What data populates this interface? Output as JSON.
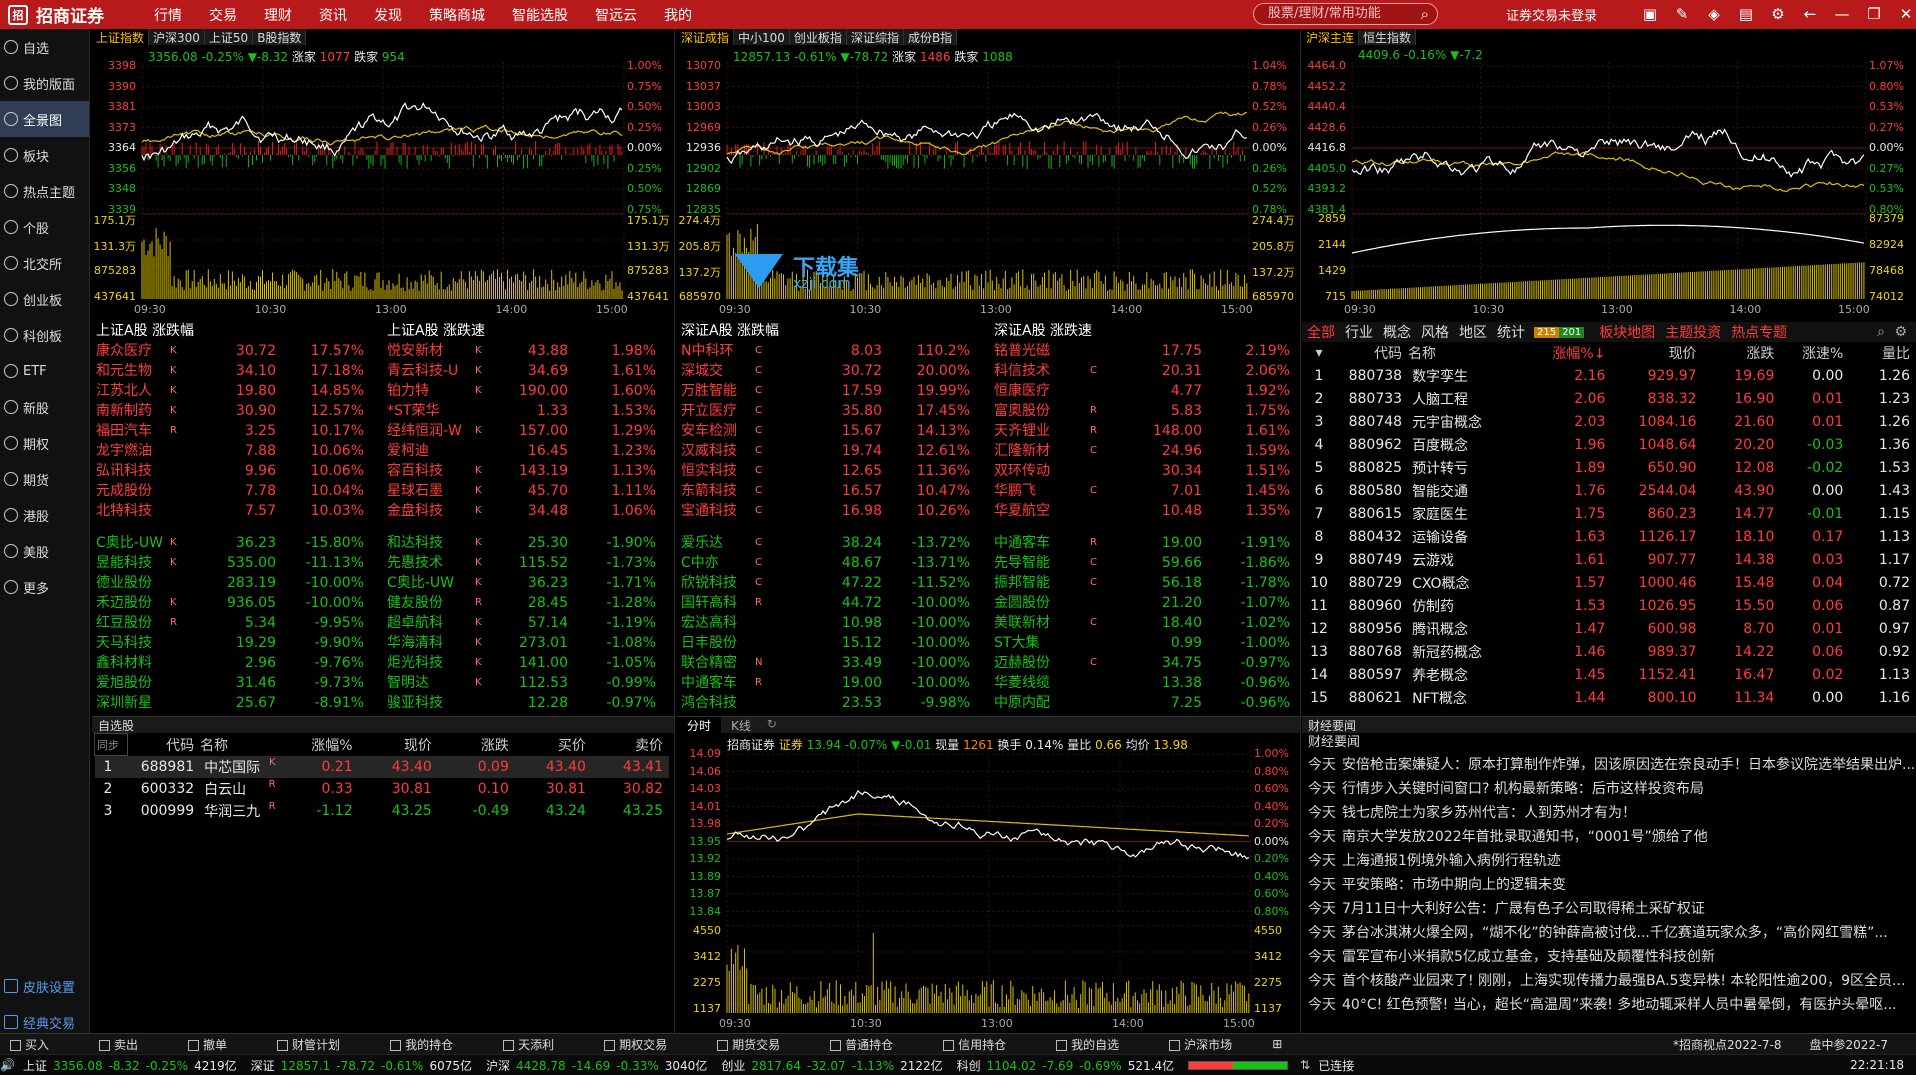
{
  "app": {
    "logo": "招商证券",
    "menu": [
      "行情",
      "交易",
      "理财",
      "资讯",
      "发现",
      "策略商城",
      "智能选股",
      "智远云",
      "我的"
    ],
    "search_placeholder": "股票/理财/常用功能",
    "login": "证券交易未登录"
  },
  "sidebar": [
    {
      "label": "自选",
      "icon": "star-icon"
    },
    {
      "label": "我的版面",
      "icon": "layout-icon"
    },
    {
      "label": "全景图",
      "icon": "panorama-icon",
      "active": true
    },
    {
      "label": "板块",
      "icon": "sector-icon"
    },
    {
      "label": "热点主题",
      "icon": "fire-icon"
    },
    {
      "label": "个股",
      "icon": "stock-icon"
    },
    {
      "label": "北交所",
      "icon": "bse-icon"
    },
    {
      "label": "创业板",
      "icon": "gem-icon"
    },
    {
      "label": "科创板",
      "icon": "star-market-icon"
    },
    {
      "label": "ETF",
      "icon": "etf-icon"
    },
    {
      "label": "新股",
      "icon": "ipo-icon"
    },
    {
      "label": "期权",
      "icon": "option-icon"
    },
    {
      "label": "期货",
      "icon": "futures-icon"
    },
    {
      "label": "港股",
      "icon": "hk-icon"
    },
    {
      "label": "美股",
      "icon": "us-icon"
    },
    {
      "label": "更多",
      "icon": "more-icon"
    }
  ],
  "sidebar_bottom": [
    "皮肤设置",
    "经典交易"
  ],
  "charts": [
    {
      "tabs": [
        "上证指数",
        "沪深300",
        "上证50",
        "B股指数"
      ],
      "quote": {
        "price": "3356.08",
        "pct": "-0.25%",
        "chg": "▼-8.32",
        "up_label": "涨家",
        "up": "1077",
        "down_label": "跌家",
        "down": "954"
      },
      "y_left": [
        "3398",
        "3390",
        "3381",
        "3373",
        "3364",
        "3356",
        "3348",
        "3339"
      ],
      "y_right": [
        "1.00%",
        "0.75%",
        "0.50%",
        "0.25%",
        "0.00%",
        "0.25%",
        "0.50%",
        "0.75%"
      ],
      "vol_left": [
        "175.1万",
        "131.3万",
        "875283",
        "437641"
      ],
      "vol_right": [
        "175.1万",
        "131.3万",
        "875283",
        "437641"
      ],
      "x": [
        "09:30",
        "10:30",
        "13:00",
        "14:00",
        "15:00"
      ]
    },
    {
      "tabs": [
        "深证成指",
        "中小100",
        "创业板指",
        "深证综指",
        "成份B指"
      ],
      "quote": {
        "price": "12857.13",
        "pct": "-0.61%",
        "chg": "▼-78.72",
        "up_label": "涨家",
        "up": "1486",
        "down_label": "跌家",
        "down": "1088"
      },
      "y_left": [
        "13070",
        "13037",
        "13003",
        "12969",
        "12936",
        "12902",
        "12869",
        "12835"
      ],
      "y_right": [
        "1.04%",
        "0.78%",
        "0.52%",
        "0.26%",
        "0.00%",
        "0.26%",
        "0.52%",
        "0.78%"
      ],
      "vol_left": [
        "274.4万",
        "205.8万",
        "137.2万",
        "685970"
      ],
      "vol_right": [
        "274.4万",
        "205.8万",
        "137.2万",
        "685970"
      ],
      "x": [
        "09:30",
        "10:30",
        "13:00",
        "14:00",
        "15:00"
      ]
    },
    {
      "tabs": [
        "沪深主连",
        "恒生指数"
      ],
      "quote": {
        "price": "4409.6",
        "pct": "-0.16%",
        "chg": "▼-7.2"
      },
      "y_left": [
        "4464.0",
        "4452.2",
        "4440.4",
        "4428.6",
        "4416.8",
        "4405.0",
        "4393.2",
        "4381.4"
      ],
      "y_right": [
        "1.07%",
        "0.80%",
        "0.53%",
        "0.27%",
        "0.00%",
        "0.27%",
        "0.53%",
        "0.80%"
      ],
      "vol_left": [
        "2859",
        "2144",
        "1429",
        "715"
      ],
      "vol_right": [
        "87379",
        "82924",
        "78468",
        "74012"
      ],
      "x": [
        "09:30",
        "10:30",
        "13:00",
        "14:00",
        "15:00"
      ]
    }
  ],
  "watermark": {
    "text": "下载集",
    "sub": "xzji.com"
  },
  "rankings": [
    {
      "title": "上证A股 涨跌幅",
      "up": [
        [
          "康众医疗",
          "K",
          "30.72",
          "17.57%"
        ],
        [
          "和元生物",
          "K",
          "34.10",
          "17.18%"
        ],
        [
          "江苏北人",
          "K",
          "19.80",
          "14.85%"
        ],
        [
          "南新制药",
          "K",
          "30.90",
          "12.57%"
        ],
        [
          "福田汽车",
          "R",
          "3.25",
          "10.17%"
        ],
        [
          "龙宇燃油",
          "",
          "7.88",
          "10.06%"
        ],
        [
          "弘讯科技",
          "",
          "9.96",
          "10.06%"
        ],
        [
          "元成股份",
          "",
          "7.78",
          "10.04%"
        ],
        [
          "北特科技",
          "",
          "7.57",
          "10.03%"
        ]
      ],
      "down": [
        [
          "C奥比-UW",
          "K",
          "36.23",
          "-15.80%"
        ],
        [
          "昱能科技",
          "K",
          "535.00",
          "-11.13%"
        ],
        [
          "德业股份",
          "",
          "283.19",
          "-10.00%"
        ],
        [
          "禾迈股份",
          "K",
          "936.05",
          "-10.00%"
        ],
        [
          "红豆股份",
          "R",
          "5.34",
          "-9.95%"
        ],
        [
          "天马科技",
          "",
          "19.29",
          "-9.90%"
        ],
        [
          "鑫科材料",
          "",
          "2.96",
          "-9.76%"
        ],
        [
          "爱旭股份",
          "",
          "31.46",
          "-9.73%"
        ],
        [
          "深圳新星",
          "",
          "25.67",
          "-8.91%"
        ]
      ]
    },
    {
      "title": "上证A股 涨跌速",
      "up": [
        [
          "悦安新材",
          "K",
          "43.88",
          "1.98%"
        ],
        [
          "青云科技-U",
          "K",
          "34.69",
          "1.61%"
        ],
        [
          "铂力特",
          "K",
          "190.00",
          "1.60%"
        ],
        [
          "*ST荣华",
          "",
          "1.33",
          "1.53%"
        ],
        [
          "经纬恒润-W",
          "K",
          "157.00",
          "1.29%"
        ],
        [
          "爱柯迪",
          "",
          "16.45",
          "1.23%"
        ],
        [
          "容百科技",
          "K",
          "143.19",
          "1.13%"
        ],
        [
          "星球石墨",
          "K",
          "45.70",
          "1.11%"
        ],
        [
          "金盘科技",
          "K",
          "34.48",
          "1.06%"
        ]
      ],
      "down": [
        [
          "和达科技",
          "K",
          "25.30",
          "-1.90%"
        ],
        [
          "先惠技术",
          "K",
          "115.52",
          "-1.73%"
        ],
        [
          "C奥比-UW",
          "K",
          "36.23",
          "-1.71%"
        ],
        [
          "健友股份",
          "R",
          "28.45",
          "-1.28%"
        ],
        [
          "超卓航科",
          "K",
          "57.14",
          "-1.19%"
        ],
        [
          "华海清科",
          "K",
          "273.01",
          "-1.08%"
        ],
        [
          "炬光科技",
          "K",
          "141.00",
          "-1.05%"
        ],
        [
          "智明达",
          "K",
          "112.53",
          "-0.99%"
        ],
        [
          "骏亚科技",
          "",
          "12.28",
          "-0.97%"
        ]
      ]
    },
    {
      "title": "深证A股 涨跌幅",
      "up": [
        [
          "N中科环",
          "C",
          "8.03",
          "110.2%"
        ],
        [
          "深城交",
          "C",
          "30.72",
          "20.00%"
        ],
        [
          "万胜智能",
          "C",
          "17.59",
          "19.99%"
        ],
        [
          "开立医疗",
          "C",
          "35.80",
          "17.45%"
        ],
        [
          "安车检测",
          "C",
          "15.67",
          "14.13%"
        ],
        [
          "汉威科技",
          "C",
          "19.74",
          "12.61%"
        ],
        [
          "恒实科技",
          "C",
          "12.65",
          "11.36%"
        ],
        [
          "东箭科技",
          "C",
          "16.57",
          "10.47%"
        ],
        [
          "宝通科技",
          "C",
          "16.98",
          "10.26%"
        ]
      ],
      "down": [
        [
          "爱乐达",
          "C",
          "38.24",
          "-13.72%"
        ],
        [
          "C中亦",
          "C",
          "48.67",
          "-13.71%"
        ],
        [
          "欣锐科技",
          "C",
          "47.22",
          "-11.52%"
        ],
        [
          "国轩高科",
          "R",
          "44.72",
          "-10.00%"
        ],
        [
          "宏达高科",
          "",
          "10.98",
          "-10.00%"
        ],
        [
          "日丰股份",
          "",
          "15.12",
          "-10.00%"
        ],
        [
          "联合精密",
          "N",
          "33.49",
          "-10.00%"
        ],
        [
          "中通客车",
          "R",
          "19.00",
          "-10.00%"
        ],
        [
          "鸿合科技",
          "",
          "23.53",
          "-9.98%"
        ]
      ]
    },
    {
      "title": "深证A股 涨跌速",
      "up": [
        [
          "铭普光磁",
          "",
          "17.75",
          "2.19%"
        ],
        [
          "科信技术",
          "C",
          "20.31",
          "2.06%"
        ],
        [
          "恒康医疗",
          "",
          "4.77",
          "1.92%"
        ],
        [
          "富奥股份",
          "R",
          "5.83",
          "1.75%"
        ],
        [
          "天齐锂业",
          "R",
          "148.00",
          "1.61%"
        ],
        [
          "汇隆新材",
          "C",
          "24.96",
          "1.59%"
        ],
        [
          "双环传动",
          "",
          "30.34",
          "1.51%"
        ],
        [
          "华鹏飞",
          "C",
          "7.01",
          "1.45%"
        ],
        [
          "华夏航空",
          "",
          "10.48",
          "1.35%"
        ]
      ],
      "down": [
        [
          "中通客车",
          "R",
          "19.00",
          "-1.91%"
        ],
        [
          "先导智能",
          "C",
          "59.66",
          "-1.86%"
        ],
        [
          "振邦智能",
          "C",
          "56.18",
          "-1.78%"
        ],
        [
          "金圆股份",
          "",
          "21.20",
          "-1.07%"
        ],
        [
          "美联新材",
          "C",
          "18.40",
          "-1.02%"
        ],
        [
          "ST大集",
          "",
          "0.99",
          "-1.00%"
        ],
        [
          "迈赫股份",
          "C",
          "34.75",
          "-0.97%"
        ],
        [
          "华菱线缆",
          "",
          "13.38",
          "-0.96%"
        ],
        [
          "中原内配",
          "",
          "7.25",
          "-0.96%"
        ]
      ]
    }
  ],
  "blocks": {
    "tabs": [
      "全部",
      "行业",
      "概念",
      "风格",
      "地区",
      "统计"
    ],
    "badge_up": "215",
    "badge_down": "201",
    "tabs2": [
      "板块地图",
      "主题投资",
      "热点专题"
    ],
    "headers": [
      "代码",
      "名称",
      "涨幅%↓",
      "现价",
      "涨跌",
      "涨速%",
      "量比"
    ],
    "rows": [
      [
        "1",
        "880738",
        "数字孪生",
        "2.16",
        "929.97",
        "19.69",
        "0.00",
        "1.26"
      ],
      [
        "2",
        "880733",
        "人脑工程",
        "2.06",
        "838.32",
        "16.90",
        "0.01",
        "1.23"
      ],
      [
        "3",
        "880748",
        "元宇宙概念",
        "2.03",
        "1084.16",
        "21.60",
        "0.01",
        "1.26"
      ],
      [
        "4",
        "880962",
        "百度概念",
        "1.96",
        "1048.64",
        "20.20",
        "-0.03",
        "1.36"
      ],
      [
        "5",
        "880825",
        "预计转亏",
        "1.89",
        "650.90",
        "12.08",
        "-0.02",
        "1.53"
      ],
      [
        "6",
        "880580",
        "智能交通",
        "1.76",
        "2544.04",
        "43.90",
        "0.00",
        "1.43"
      ],
      [
        "7",
        "880615",
        "家庭医生",
        "1.75",
        "860.23",
        "14.77",
        "-0.01",
        "1.15"
      ],
      [
        "8",
        "880432",
        "运输设备",
        "1.63",
        "1126.17",
        "18.10",
        "0.17",
        "1.13"
      ],
      [
        "9",
        "880749",
        "云游戏",
        "1.61",
        "907.77",
        "14.38",
        "0.03",
        "1.17"
      ],
      [
        "10",
        "880729",
        "CXO概念",
        "1.57",
        "1000.46",
        "15.48",
        "0.04",
        "0.72"
      ],
      [
        "11",
        "880960",
        "仿制药",
        "1.53",
        "1026.95",
        "15.50",
        "0.06",
        "0.87"
      ],
      [
        "12",
        "880956",
        "腾讯概念",
        "1.47",
        "600.98",
        "8.70",
        "0.01",
        "0.97"
      ],
      [
        "13",
        "880768",
        "新冠药概念",
        "1.46",
        "989.37",
        "14.22",
        "0.06",
        "0.92"
      ],
      [
        "14",
        "880597",
        "养老概念",
        "1.45",
        "1152.41",
        "16.47",
        "0.02",
        "1.13"
      ],
      [
        "15",
        "880621",
        "NFT概念",
        "1.44",
        "800.10",
        "11.34",
        "0.00",
        "1.16"
      ]
    ]
  },
  "watchlist": {
    "title": "自选股",
    "sync": "同步",
    "headers": [
      "代码",
      "名称",
      "涨幅%",
      "现价",
      "涨跌",
      "买价",
      "卖价"
    ],
    "rows": [
      [
        "1",
        "688981",
        "中芯国际",
        "K",
        "0.21",
        "43.40",
        "0.09",
        "43.40",
        "43.41"
      ],
      [
        "2",
        "600332",
        "白云山",
        "R",
        "0.33",
        "30.81",
        "0.10",
        "30.81",
        "30.82"
      ],
      [
        "3",
        "000999",
        "华润三九",
        "R",
        "-1.12",
        "43.25",
        "-0.49",
        "43.24",
        "43.25"
      ]
    ]
  },
  "intraday": {
    "tabs": [
      "分时",
      "K线"
    ],
    "name": "招商证券",
    "board": "证券",
    "price": "13.94",
    "pct": "-0.07%",
    "chg": "▼-0.01",
    "vol_label": "现量",
    "vol": "1261",
    "turnover": "换手 0.14%",
    "ratio_label": "量比",
    "ratio": "0.66",
    "avg_label": "均价",
    "avg": "13.98",
    "y_left": [
      "14.09",
      "14.06",
      "14.03",
      "14.01",
      "13.98",
      "13.95",
      "13.92",
      "13.89",
      "13.87",
      "13.84"
    ],
    "y_right": [
      "1.00%",
      "0.80%",
      "0.60%",
      "0.40%",
      "0.20%",
      "0.00%",
      "0.20%",
      "0.40%",
      "0.60%",
      "0.80%"
    ],
    "vol_left": [
      "4550",
      "3412",
      "2275",
      "1137"
    ],
    "vol_right": [
      "4550",
      "3412",
      "2275",
      "1137"
    ],
    "x": [
      "09:30",
      "10:30",
      "13:00",
      "14:00",
      "15:00"
    ]
  },
  "news": {
    "title": "财经要闻",
    "sub": "财经要闻",
    "items": [
      [
        "今天",
        "安倍枪击案嫌疑人：原本打算制作炸弹，因该原因选在奈良动手！日本参议院选举结果出炉..."
      ],
      [
        "今天",
        "行情步入关键时间窗口? 机构最新策略：后市这样投资布局"
      ],
      [
        "今天",
        "钱七虎院士为家乡苏州代言：人到苏州才有为！"
      ],
      [
        "今天",
        "南京大学发放2022年首批录取通知书，“0001号”颁给了他"
      ],
      [
        "今天",
        "上海通报1例境外输入病例行程轨迹"
      ],
      [
        "今天",
        "平安策略：市场中期向上的逻辑未变"
      ],
      [
        "今天",
        "7月11日十大利好公告：广晟有色子公司取得稀土采矿权证"
      ],
      [
        "今天",
        "茅台冰淇淋火爆全网，“煳不化”的钟薛高被讨伐...千亿赛道玩家众多，“高价网红雪糕”..."
      ],
      [
        "今天",
        "雷军宣布小米捐款5亿成立基金，支持基础及颠覆性科技创新"
      ],
      [
        "今天",
        "首个核酸产业园来了! 刚刚，上海实现传播力最强BA.5变异株! 本轮阳性逾200，9区全员..."
      ],
      [
        "今天",
        "40°C! 红色预警! 当心，超长“高温周”来袭! 多地动辄采样人员中暑晕倒，有医护头晕呕..."
      ]
    ]
  },
  "tradebar": [
    "买入",
    "卖出",
    "撤单",
    "财管计划",
    "我的持仓",
    "天添利",
    "期权交易",
    "期货交易",
    "普通持仓",
    "信用持仓",
    "我的自选",
    "沪深市场"
  ],
  "tradebar_right": [
    "*招商视点2022-7-8",
    "盘中参2022-7"
  ],
  "status": {
    "sh": [
      "上证",
      "3356.08",
      "-8.32",
      "-0.25%",
      "4219亿"
    ],
    "sz": [
      "深证",
      "12857.1",
      "-78.72",
      "-0.61%",
      "6075亿"
    ],
    "hs": [
      "沪深",
      "4428.78",
      "-14.69",
      "-0.33%",
      "3040亿"
    ],
    "cy": [
      "创业",
      "2817.64",
      "-32.07",
      "-1.13%",
      "2122亿"
    ],
    "kc": [
      "科创",
      "1104.02",
      "-7.69",
      "-0.69%",
      "521.4亿"
    ],
    "conn": "已连接",
    "time": "22:21:18"
  }
}
